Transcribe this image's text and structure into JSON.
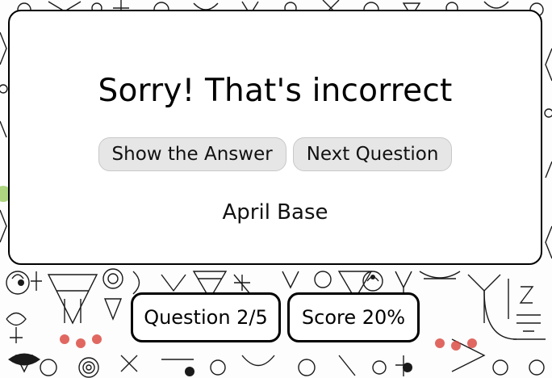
{
  "modal": {
    "title": "Sorry! That's incorrect",
    "show_answer_label": "Show the Answer",
    "next_question_label": "Next Question",
    "answer": "April Base"
  },
  "status": {
    "question": "Question 2/5",
    "score": "Score 20%"
  },
  "colors": {
    "background_pattern": "#1a1a1a",
    "accent_red": "#d9443b",
    "accent_green": "#8bc34a",
    "button_bg": "#e6e6e6"
  }
}
